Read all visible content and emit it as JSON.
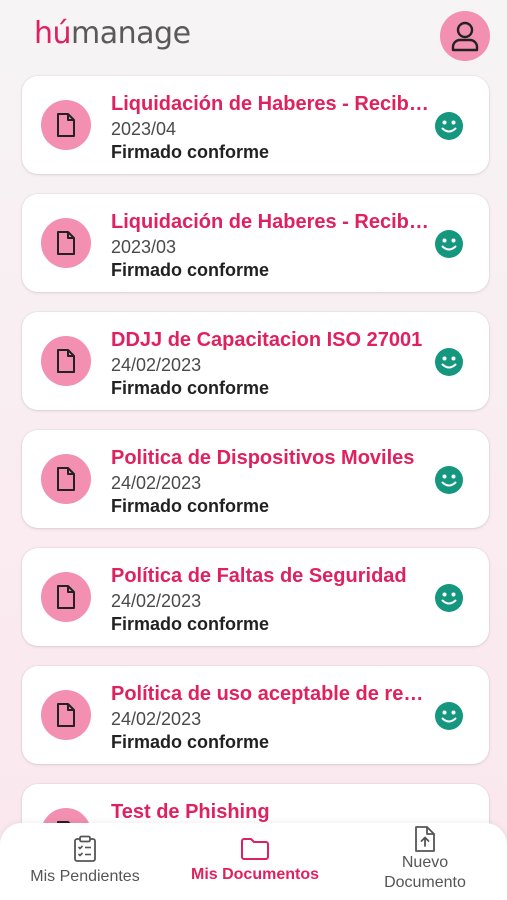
{
  "header": {
    "logo_hu": "hú",
    "logo_manage": "manage",
    "profile_icon": "user-icon"
  },
  "documents": [
    {
      "title": "Liquidación de Haberes - Recibo de sueldo",
      "date": "2023/04",
      "status": "Firmado conforme"
    },
    {
      "title": "Liquidación de Haberes - Recibo de sueldo",
      "date": "2023/03",
      "status": "Firmado conforme"
    },
    {
      "title": "DDJJ de Capacitacion ISO 27001",
      "date": "24/02/2023",
      "status": "Firmado conforme"
    },
    {
      "title": "Politica de Dispositivos Moviles",
      "date": "24/02/2023",
      "status": "Firmado conforme"
    },
    {
      "title": "Política de Faltas de Seguridad",
      "date": "24/02/2023",
      "status": "Firmado conforme"
    },
    {
      "title": "Política de uso aceptable de recursos",
      "date": "24/02/2023",
      "status": "Firmado conforme"
    },
    {
      "title": "Test de Phishing",
      "date": "",
      "status": ""
    }
  ],
  "nav": {
    "pending_label": "Mis Pendientes",
    "documents_label": "Mis Documentos",
    "new_label_line1": "Nuevo",
    "new_label_line2": "Documento"
  },
  "colors": {
    "accent": "#e0215f",
    "accent_soft": "#f38fb0",
    "status_ok": "#14967f"
  }
}
